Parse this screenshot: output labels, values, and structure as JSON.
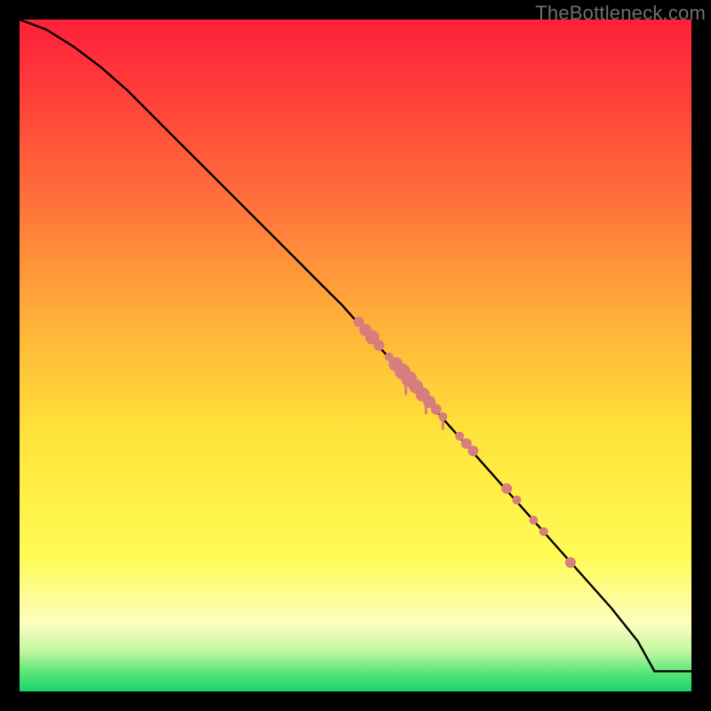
{
  "watermark": "TheBottleneck.com",
  "colors": {
    "curve": "#000000",
    "marker_fill": "#d87d7d",
    "marker_stroke": "#c86a6a"
  },
  "chart_data": {
    "type": "line",
    "title": "",
    "xlabel": "",
    "ylabel": "",
    "xlim": [
      0,
      100
    ],
    "ylim": [
      0,
      100
    ],
    "grid": false,
    "legend": false,
    "series": [
      {
        "name": "curve",
        "x": [
          0,
          4,
          8,
          12,
          16,
          20,
          24,
          28,
          32,
          36,
          40,
          44,
          48,
          52,
          56,
          60,
          64,
          68,
          72,
          76,
          80,
          84,
          88,
          92,
          94.5,
          100
        ],
        "y": [
          100,
          98.5,
          96,
          93,
          89.5,
          85.5,
          81.5,
          77.5,
          73.5,
          69.5,
          65.5,
          61.5,
          57.5,
          53,
          48.5,
          44,
          39.5,
          35,
          30.5,
          26,
          21.5,
          17,
          12.5,
          7.5,
          3,
          3
        ]
      }
    ],
    "markers": [
      {
        "x": 50.5,
        "y": 55.0,
        "r": 6
      },
      {
        "x": 51.5,
        "y": 53.8,
        "r": 7
      },
      {
        "x": 52.5,
        "y": 52.7,
        "r": 8
      },
      {
        "x": 53.5,
        "y": 51.5,
        "r": 6
      },
      {
        "x": 55.0,
        "y": 49.8,
        "r": 5
      },
      {
        "x": 56.0,
        "y": 48.7,
        "r": 8
      },
      {
        "x": 57.0,
        "y": 47.6,
        "r": 9
      },
      {
        "x": 58.0,
        "y": 46.5,
        "r": 9
      },
      {
        "x": 59.0,
        "y": 45.4,
        "r": 8
      },
      {
        "x": 60.0,
        "y": 44.2,
        "r": 8
      },
      {
        "x": 61.0,
        "y": 43.1,
        "r": 7
      },
      {
        "x": 62.0,
        "y": 42.0,
        "r": 6
      },
      {
        "x": 63.0,
        "y": 40.9,
        "r": 5
      },
      {
        "x": 65.5,
        "y": 38.0,
        "r": 5
      },
      {
        "x": 66.5,
        "y": 36.9,
        "r": 6
      },
      {
        "x": 67.5,
        "y": 35.8,
        "r": 6
      },
      {
        "x": 72.5,
        "y": 30.2,
        "r": 6
      },
      {
        "x": 74.0,
        "y": 28.5,
        "r": 5
      },
      {
        "x": 76.5,
        "y": 25.5,
        "r": 5
      },
      {
        "x": 78.0,
        "y": 23.8,
        "r": 5
      },
      {
        "x": 82.0,
        "y": 19.2,
        "r": 6
      }
    ],
    "drips": [
      {
        "x": 57.5,
        "len": 2.5
      },
      {
        "x": 60.5,
        "len": 2.0
      },
      {
        "x": 63.0,
        "len": 1.5
      }
    ]
  }
}
